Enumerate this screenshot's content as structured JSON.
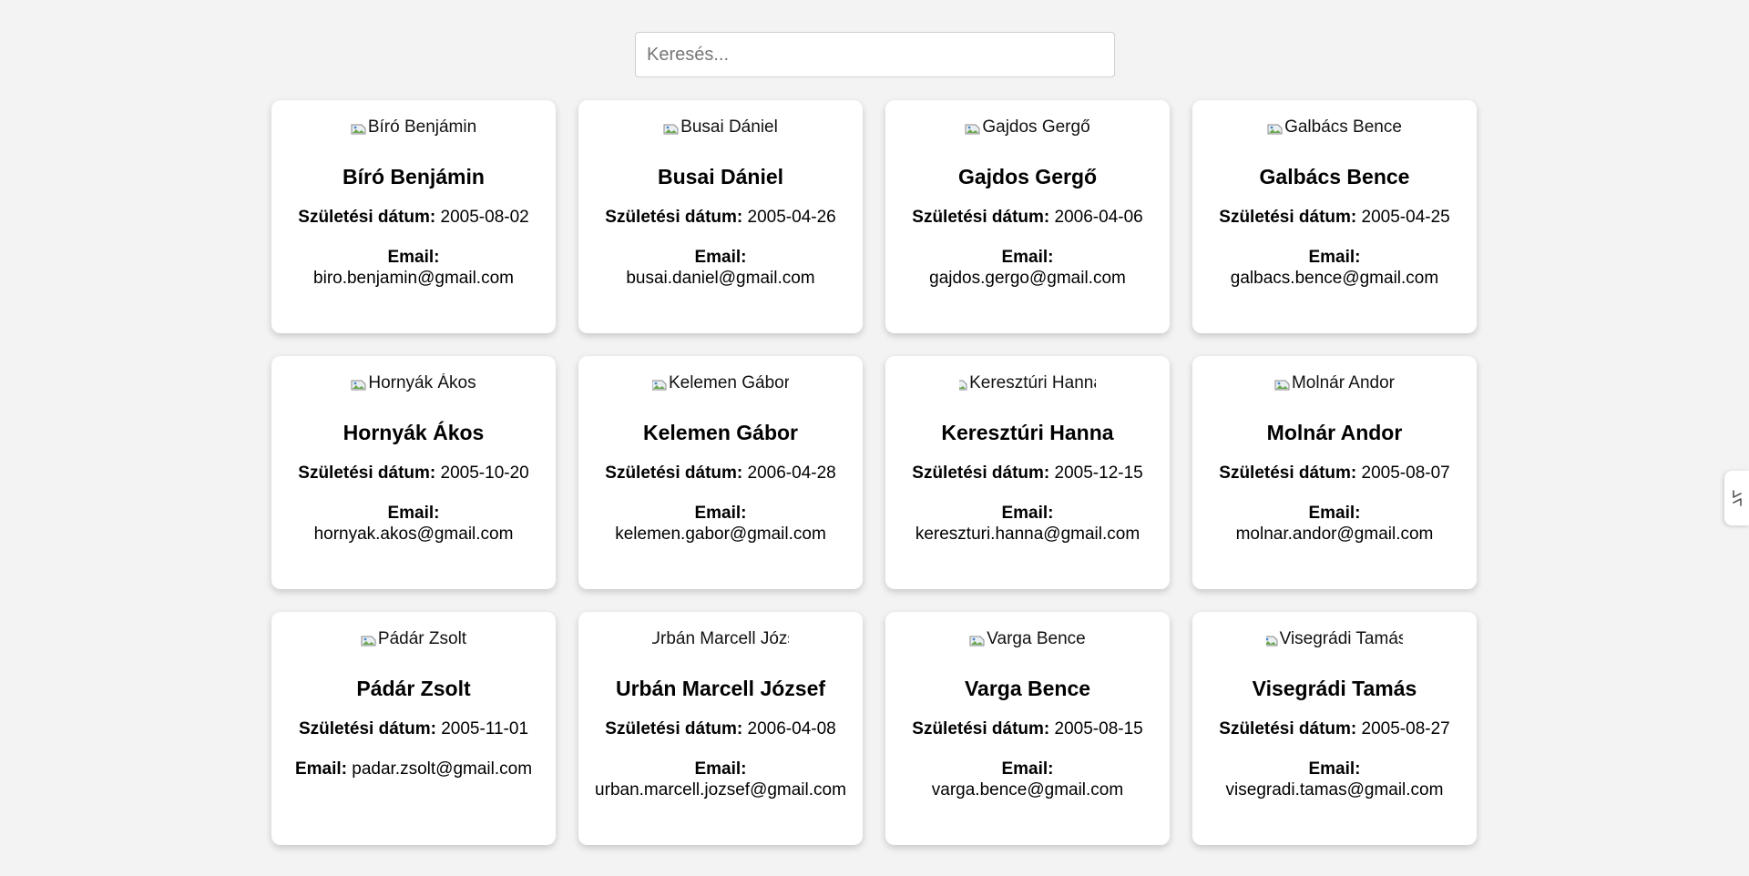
{
  "search": {
    "placeholder": "Keresés..."
  },
  "labels": {
    "dob": "Születési dátum:",
    "email": "Email:"
  },
  "people": [
    {
      "name": "Bíró Benjámin",
      "dob": "2005-08-02",
      "email": "biro.benjamin@gmail.com"
    },
    {
      "name": "Busai Dániel",
      "dob": "2005-04-26",
      "email": "busai.daniel@gmail.com"
    },
    {
      "name": "Gajdos Gergő",
      "dob": "2006-04-06",
      "email": "gajdos.gergo@gmail.com"
    },
    {
      "name": "Galbács Bence",
      "dob": "2005-04-25",
      "email": "galbacs.bence@gmail.com"
    },
    {
      "name": "Hornyák Ákos",
      "dob": "2005-10-20",
      "email": "hornyak.akos@gmail.com"
    },
    {
      "name": "Kelemen Gábor",
      "dob": "2006-04-28",
      "email": "kelemen.gabor@gmail.com"
    },
    {
      "name": "Keresztúri Hanna",
      "dob": "2005-12-15",
      "email": "kereszturi.hanna@gmail.com"
    },
    {
      "name": "Molnár Andor",
      "dob": "2005-08-07",
      "email": "molnar.andor@gmail.com"
    },
    {
      "name": "Pádár Zsolt",
      "dob": "2005-11-01",
      "email": "padar.zsolt@gmail.com",
      "email_inline": true
    },
    {
      "name": "Urbán Marcell József",
      "dob": "2006-04-08",
      "email": "urban.marcell.jozsef@gmail.com"
    },
    {
      "name": "Varga Bence",
      "dob": "2005-08-15",
      "email": "varga.bence@gmail.com"
    },
    {
      "name": "Visegrádi Tamás",
      "dob": "2005-08-27",
      "email": "visegradi.tamas@gmail.com"
    }
  ],
  "icons": {
    "broken_image": "broken-image-icon",
    "side_tab": "sidebar-toggle-icon"
  },
  "colors": {
    "background": "#f3f3f3",
    "card": "#ffffff"
  }
}
